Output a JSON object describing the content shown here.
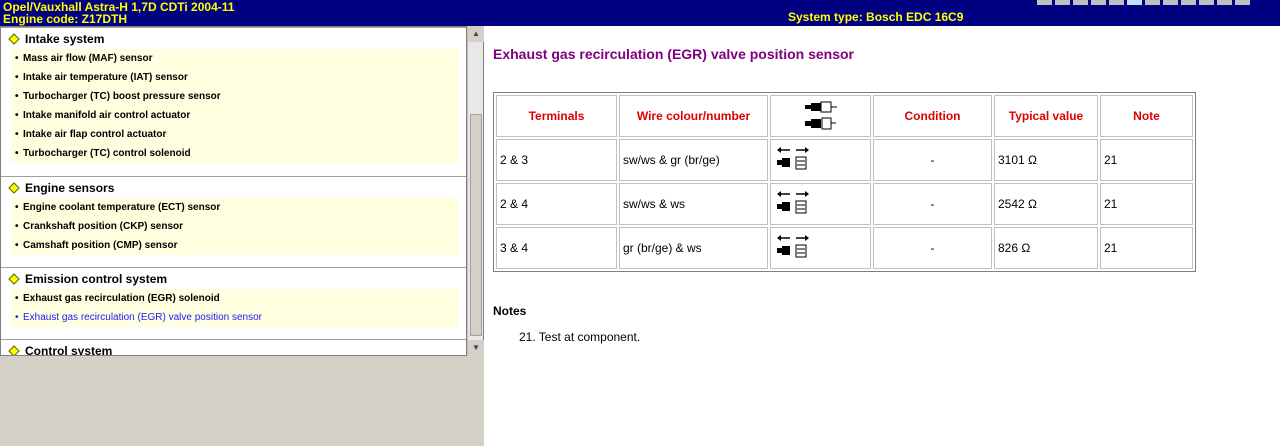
{
  "header": {
    "line1": "Opel/Vauxhall   Astra-H   1,7D CDTi 2004-11",
    "line2": "Engine code: Z17DTH",
    "system_type": "System type: Bosch EDC 16C9"
  },
  "tree": {
    "sections": [
      {
        "title": "Intake system",
        "items": [
          "Mass air flow (MAF) sensor",
          "Intake air temperature (IAT) sensor",
          "Turbocharger (TC) boost pressure sensor",
          "Intake manifold air control actuator",
          "Intake air flap control actuator",
          "Turbocharger (TC) control solenoid"
        ]
      },
      {
        "title": "Engine sensors",
        "items": [
          "Engine coolant temperature (ECT) sensor",
          "Crankshaft position (CKP) sensor",
          "Camshaft position (CMP) sensor"
        ]
      },
      {
        "title": "Emission control system",
        "items": [
          "Exhaust gas recirculation (EGR) solenoid",
          "Exhaust gas recirculation (EGR) valve position sensor"
        ]
      },
      {
        "title": "Control system",
        "items": []
      }
    ]
  },
  "content": {
    "title": "Exhaust gas recirculation (EGR) valve position sensor",
    "table": {
      "headers": [
        "Terminals",
        "Wire colour/number",
        "",
        "Condition",
        "Typical value",
        "Note"
      ],
      "rows": [
        {
          "terminals": "2 & 3",
          "wire": "sw/ws & gr (br/ge)",
          "condition": "-",
          "value": "3101 Ω",
          "note": "21"
        },
        {
          "terminals": "2 & 4",
          "wire": "sw/ws & ws",
          "condition": "-",
          "value": "2542 Ω",
          "note": "21"
        },
        {
          "terminals": "3 & 4",
          "wire": "gr (br/ge) & ws",
          "condition": "-",
          "value": "826 Ω",
          "note": "21"
        }
      ]
    },
    "notes_title": "Notes",
    "notes": [
      "21. Test at component."
    ]
  },
  "colors": {
    "header_bg": "#000080",
    "header_text": "#ffff00",
    "title": "#800080",
    "table_header": "#e00000",
    "active_link": "#1a1aff",
    "item_bg": "#ffffe0"
  },
  "icons": {
    "section": "yellow-diamond-icon",
    "connector": "connector-icon",
    "scroll_up": "scroll-up-arrow-icon",
    "scroll_down": "scroll-down-arrow-icon"
  }
}
